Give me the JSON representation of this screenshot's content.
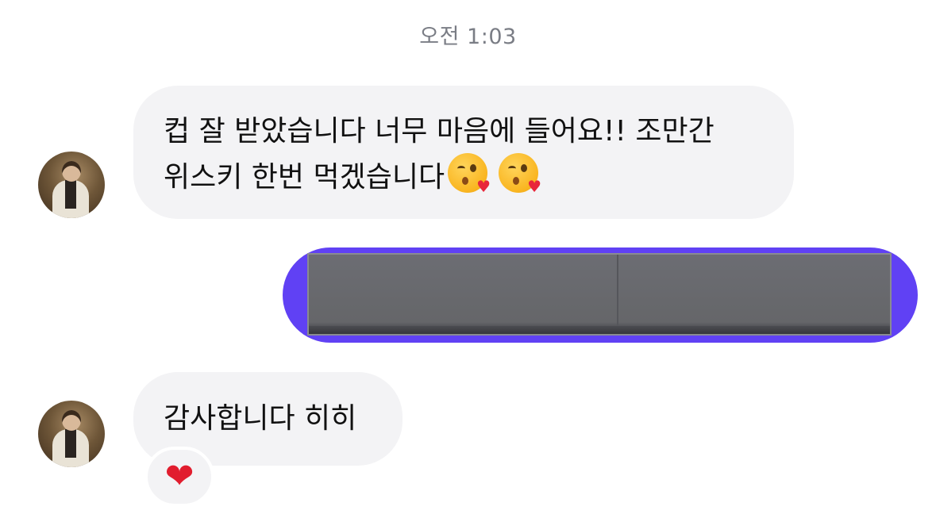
{
  "timestamp": "오전 1:03",
  "messages": [
    {
      "direction": "incoming",
      "line1": "컵 잘 받았습니다 너무 마음에 들어요!! 조만간",
      "line2": "위스키 한번 먹겠습니다",
      "emojis": [
        "kissing-face-heart",
        "kissing-face-heart"
      ]
    },
    {
      "direction": "outgoing",
      "type": "image",
      "bubble_color": "#6041f4"
    },
    {
      "direction": "incoming",
      "text": "감사합니다 히히",
      "reaction": "heart"
    }
  ],
  "colors": {
    "incoming_bubble": "#f3f3f5",
    "outgoing_bubble": "#6041f4",
    "reaction_heart": "#e11d2e"
  }
}
